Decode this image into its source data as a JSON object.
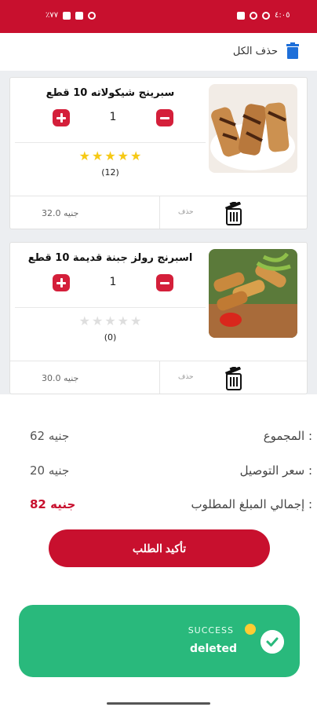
{
  "statusbar": {
    "time": "٤:٠٥",
    "battery": "٪٧٧"
  },
  "toolbar": {
    "delete_all_label": "حذف الكل"
  },
  "cart": {
    "items": [
      {
        "title": "سبرينج شيكولاته 10 قطع",
        "quantity": "1",
        "rating_count": "(12)",
        "rating_value": 5,
        "price": "32.0 جنيه",
        "delete_label": "حذف"
      },
      {
        "title": "اسبرنج رولز جبنة قديمة 10 قطع",
        "quantity": "1",
        "rating_count": "(0)",
        "rating_value": 0,
        "price": "30.0 جنيه",
        "delete_label": "حذف"
      }
    ]
  },
  "summary": {
    "subtotal_label": "المجموع :",
    "subtotal_value": "62 جنيه",
    "delivery_label": "سعر التوصيل :",
    "delivery_value": "20 جنيه",
    "total_label": "إجمالي المبلغ المطلوب :",
    "total_value": "82 جنيه"
  },
  "confirm_button_label": "تأكيد الطلب",
  "toast": {
    "title": "SUCCESS",
    "message": "deleted"
  },
  "colors": {
    "brand": "#c8102e",
    "toast": "#29b97c",
    "star_on": "#f6c915",
    "star_off": "#dedede"
  }
}
